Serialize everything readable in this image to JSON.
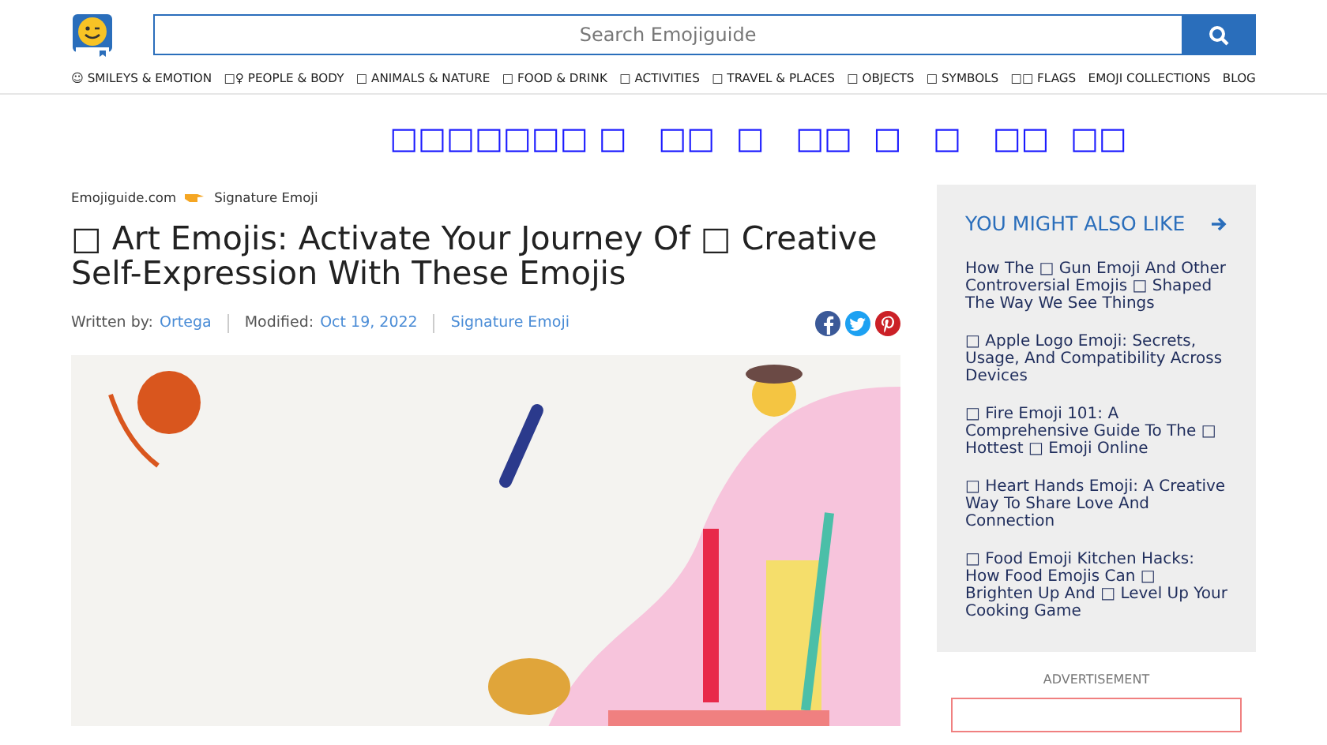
{
  "header": {
    "search": {
      "placeholder": "Search Emojiguide"
    },
    "nav": [
      "☺ SMILEYS & EMOTION",
      "□♀ PEOPLE & BODY",
      "□ ANIMALS & NATURE",
      "□ FOOD & DRINK",
      "□ ACTIVITIES",
      "□ TRAVEL & PLACES",
      "□ OBJECTS",
      "□ SYMBOLS",
      "□□ FLAGS",
      "EMOJI COLLECTIONS",
      "BLOG"
    ]
  },
  "promo": "□□□□□□□ □   □□  □   □□  □   □   □□  □□",
  "breadcrumb": [
    "Emojiguide.com",
    "Signature Emoji"
  ],
  "article": {
    "title": "□ Art Emojis: Activate Your Journey Of □ Creative Self-Expression With These Emojis",
    "meta": [
      {
        "label": "Written by:",
        "value": "Ortega"
      },
      {
        "label": "Modified:",
        "value": "Oct 19, 2022"
      },
      {
        "value": "Signature Emoji"
      }
    ],
    "share": [
      {
        "kind": "facebook",
        "color": "#3b5998"
      },
      {
        "kind": "twitter",
        "color": "#1da1f2"
      },
      {
        "kind": "pinterest",
        "color": "#cb2027"
      }
    ]
  },
  "sidebar": {
    "title": "YOU MIGHT ALSO LIKE",
    "links": [
      "How The □ Gun Emoji And Other Controversial Emojis □ Shaped The Way We See Things",
      "□ Apple Logo Emoji: Secrets, Usage, And Compatibility Across Devices",
      "□ Fire Emoji 101: A Comprehensive Guide To The □ Hottest □ Emoji Online",
      "□ Heart Hands Emoji: A Creative Way To Share Love And Connection",
      "□ Food Emoji Kitchen Hacks: How Food Emojis Can □ Brighten Up And □ Level Up Your Cooking Game"
    ]
  },
  "advertisement": {
    "label": "ADVERTISEMENT"
  }
}
